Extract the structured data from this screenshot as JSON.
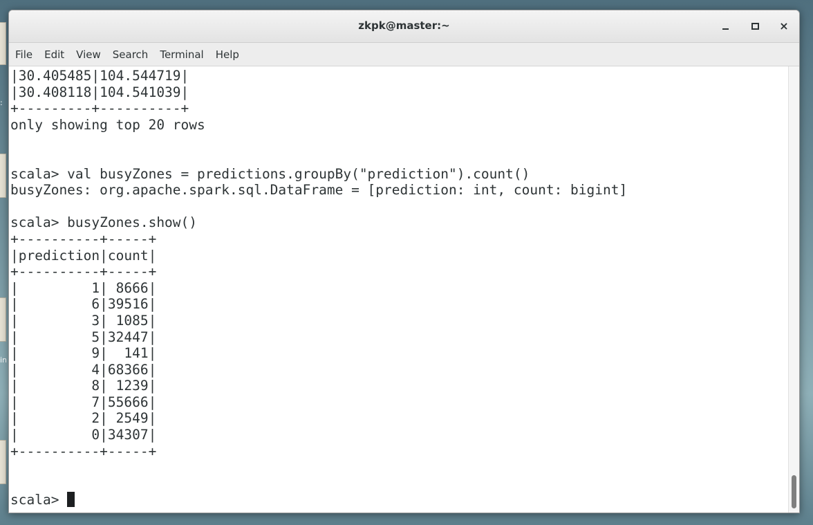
{
  "desktop": {
    "labels": [
      ":",
      "in"
    ]
  },
  "window": {
    "title": "zkpk@master:~",
    "buttons": {
      "minimize_icon": "minimize-icon",
      "maximize_icon": "maximize-icon",
      "close_glyph": "×"
    }
  },
  "menu": {
    "items": [
      "File",
      "Edit",
      "View",
      "Search",
      "Terminal",
      "Help"
    ]
  },
  "terminal": {
    "lines": [
      "|30.405485|104.544719|",
      "|30.408118|104.541039|",
      "+---------+----------+",
      "only showing top 20 rows",
      "",
      "",
      "scala> val busyZones = predictions.groupBy(\"prediction\").count()",
      "busyZones: org.apache.spark.sql.DataFrame = [prediction: int, count: bigint]",
      "",
      "scala> busyZones.show()",
      "+----------+-----+",
      "|prediction|count|",
      "+----------+-----+",
      "|         1| 8666|",
      "|         6|39516|",
      "|         3| 1085|",
      "|         5|32447|",
      "|         9|  141|",
      "|         4|68366|",
      "|         8| 1239|",
      "|         7|55666|",
      "|         2| 2549|",
      "|         0|34307|",
      "+----------+-----+",
      "",
      ""
    ],
    "prompt": "scala> "
  }
}
